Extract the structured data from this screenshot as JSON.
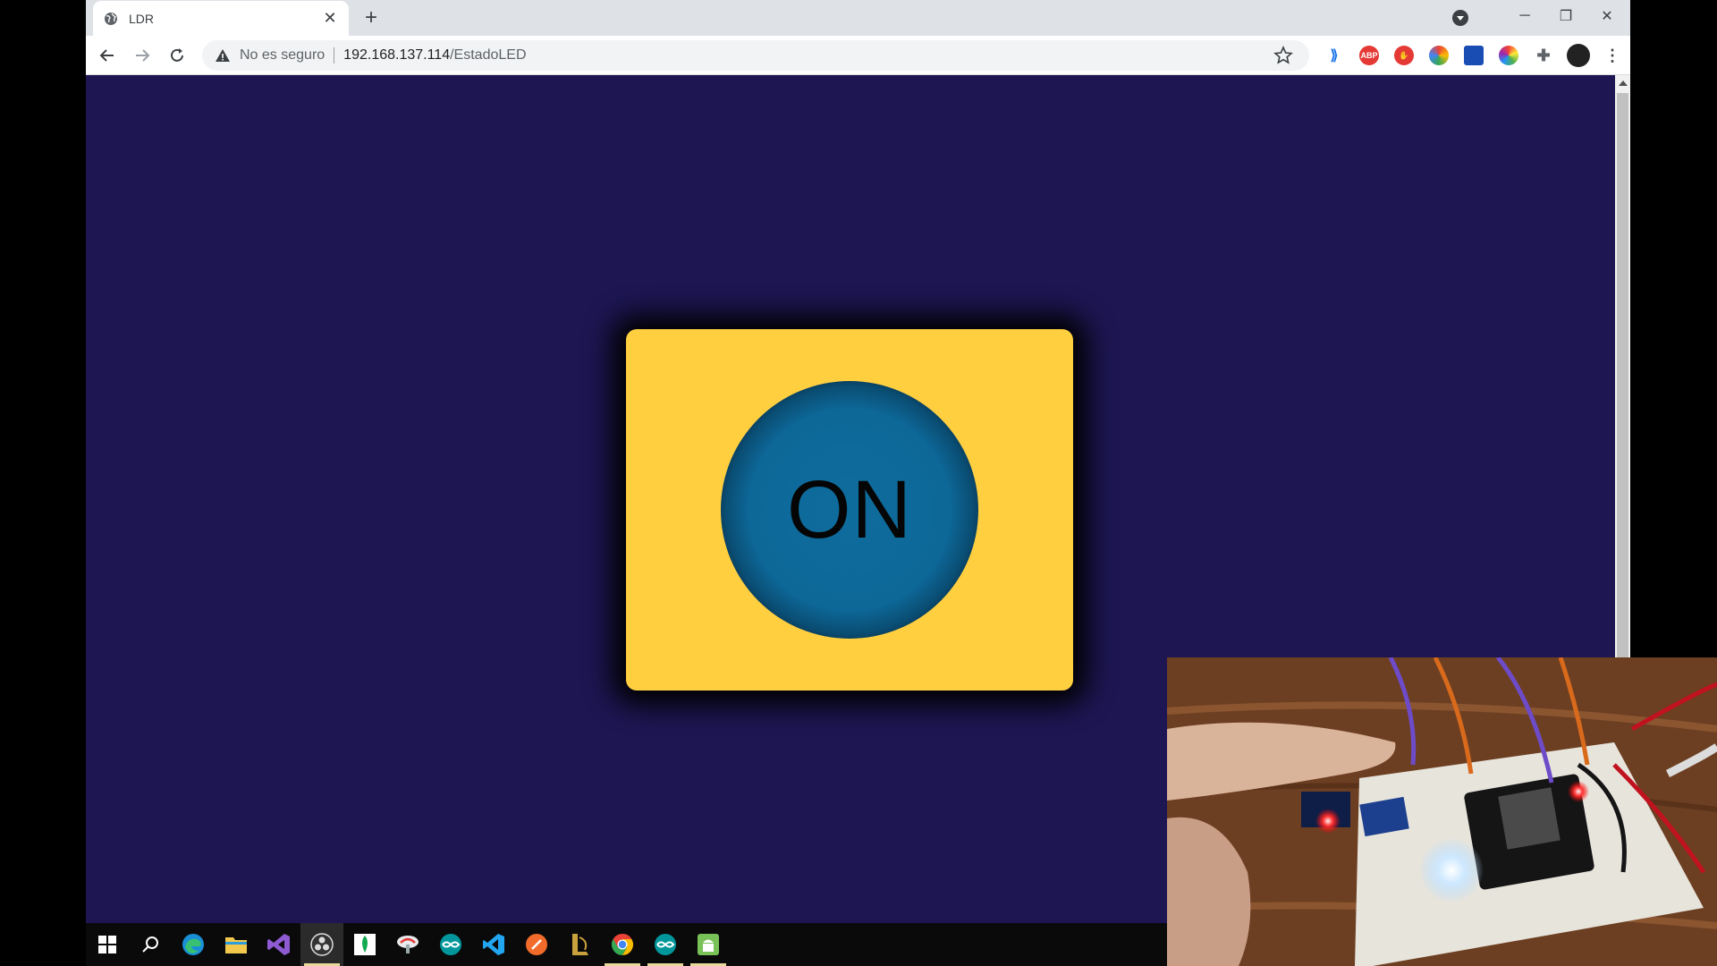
{
  "browser": {
    "tab_title": "LDR",
    "close_tab": "✕",
    "new_tab": "+",
    "security_label": "No es seguro",
    "url_host": "192.168.137.114",
    "url_path": "/EstadoLED",
    "window_controls": {
      "minimize": "─",
      "restore": "❐",
      "close": "✕"
    }
  },
  "page": {
    "background_color": "#1d1652",
    "card_color": "#ffcf40",
    "button_color": "#0e6c9c",
    "button_label": "ON"
  },
  "taskbar": {
    "items": [
      "windows-start-icon",
      "search-icon",
      "edge-icon",
      "file-explorer-icon",
      "visual-studio-icon",
      "obs-icon",
      "mongodb-icon",
      "app-icon",
      "arduino-icon",
      "vscode-icon",
      "app-orange-icon",
      "league-icon",
      "chrome-icon",
      "arduino-icon-2",
      "android-icon"
    ]
  },
  "webcam": {
    "description_icon": "webcam-feed"
  }
}
